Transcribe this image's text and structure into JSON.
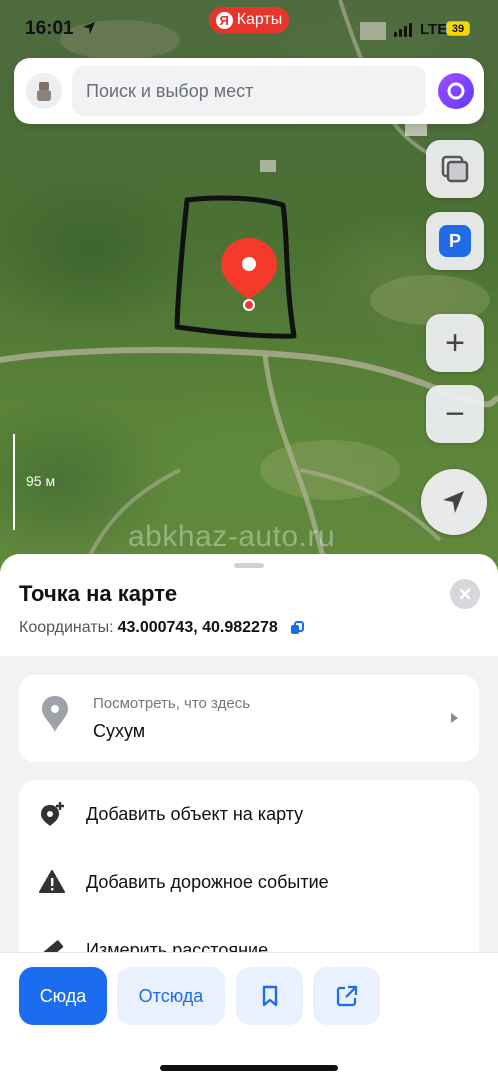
{
  "status_bar": {
    "time": "16:01",
    "network": "LTE",
    "battery": "39"
  },
  "app_badge": {
    "logo_letter": "Я",
    "label": "Карты"
  },
  "search": {
    "placeholder": "Поиск и выбор мест"
  },
  "map": {
    "scale_label": "95 м",
    "watermark": "abkhaz-auto.ru",
    "parking_label": "P",
    "zoom_in_label": "+",
    "zoom_out_label": "−"
  },
  "place": {
    "title": "Точка на карте",
    "coords_label": "Координаты:",
    "coords_value": "43.000743, 40.982278"
  },
  "whats_here": {
    "subtitle": "Посмотреть, что здесь",
    "city": "Сухум"
  },
  "actions": [
    {
      "label": "Добавить объект на карту",
      "icon": "add-place-icon"
    },
    {
      "label": "Добавить дорожное событие",
      "icon": "warning-icon"
    },
    {
      "label": "Измерить расстояние",
      "icon": "ruler-icon"
    }
  ],
  "bottom_buttons": {
    "here": "Сюда",
    "from": "Отсюда"
  },
  "colors": {
    "accent": "#1c6cf0",
    "pin": "#f33a2b",
    "badge": "#e8352b"
  }
}
